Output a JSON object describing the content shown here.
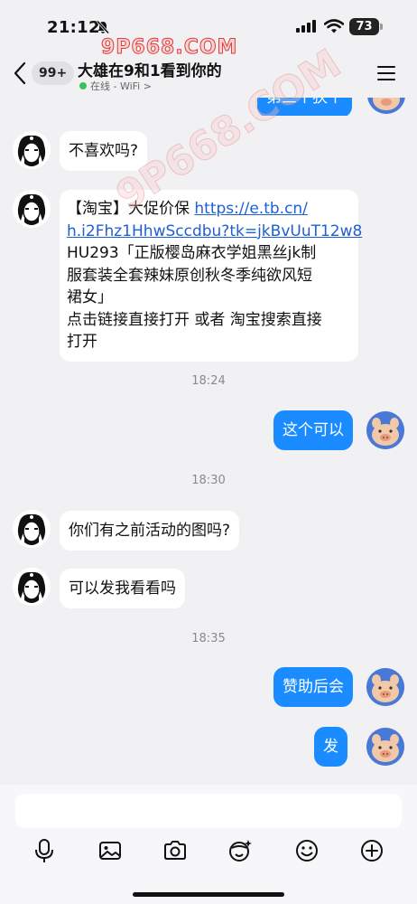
{
  "status": {
    "time": "21:12",
    "battery": "73"
  },
  "watermark": {
    "top": "9P668.COM",
    "diagonal": "9P668.COM"
  },
  "header": {
    "unread_count": "99+",
    "title": "大雄在9和1看到你的",
    "status_text": "在线 - WiFi >"
  },
  "messages": {
    "top_partial": "第三个狭个",
    "m1": "不喜欢吗?",
    "m2": {
      "prefix": "【淘宝】大促价保 ",
      "link_line1": "https://e.tb.cn/",
      "link_line2": "h.i2Fhz1HhwSccdbu?tk=jkBvUuT12w8",
      "line3": " HU293「正版樱岛麻衣学姐黑丝jk制",
      "line4": "服套装全套辣妹原创秋冬季纯欲风短",
      "line5": "裙女」",
      "line6": "点击链接直接打开 或者 淘宝搜索直接",
      "line7": "打开"
    },
    "ts1": "18:24",
    "m3": "这个可以",
    "ts2": "18:30",
    "m4": "你们有之前活动的图吗?",
    "m5": "可以发我看看吗",
    "ts3": "18:35",
    "m6": "赞助后会",
    "m7": "发"
  },
  "composer": {
    "placeholder": "",
    "icons": [
      "microphone-icon",
      "image-icon",
      "camera-icon",
      "sticker-icon",
      "emoji-icon",
      "plus-icon"
    ]
  },
  "colors": {
    "outgoing_bubble": "#1a8cff",
    "incoming_bubble": "#ffffff",
    "background": "#f1f1f3",
    "online_dot": "#3bc15b",
    "link": "#1e5fd6"
  }
}
